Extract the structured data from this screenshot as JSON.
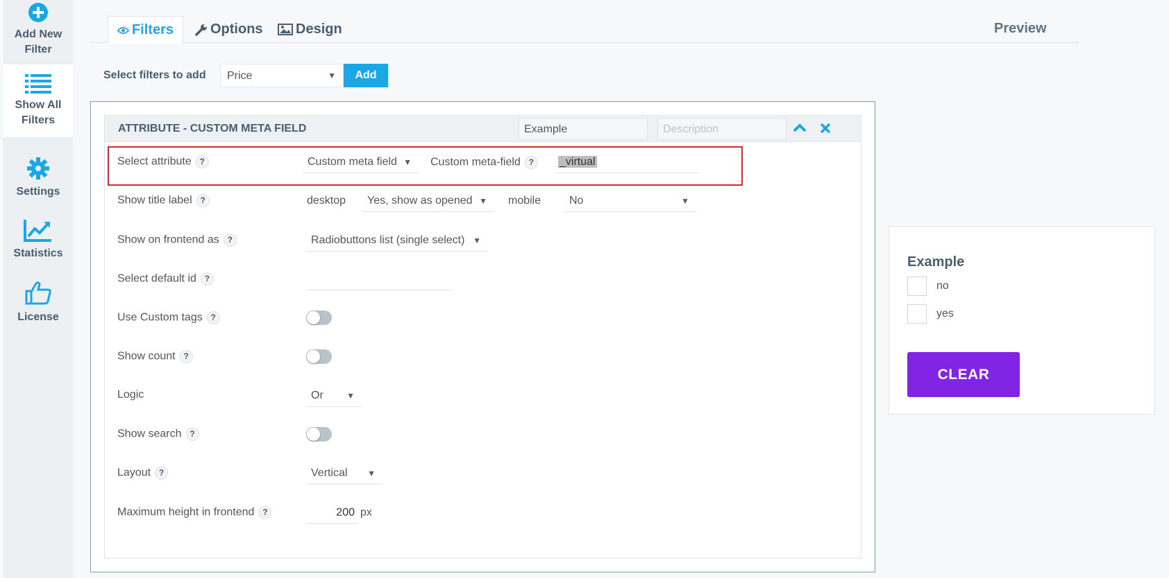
{
  "sidebar": {
    "items": [
      {
        "label_line1": "Add New",
        "label_line2": "Filter",
        "icon": "plus-circle-icon"
      },
      {
        "label_line1": "Show All",
        "label_line2": "Filters",
        "icon": "list-icon"
      },
      {
        "label_line1": "Settings",
        "icon": "gear-icon"
      },
      {
        "label_line1": "Statistics",
        "icon": "chart-line-icon"
      },
      {
        "label_line1": "License",
        "icon": "thumbs-up-icon"
      }
    ]
  },
  "tabs": {
    "filters": "Filters",
    "options": "Options",
    "design": "Design",
    "active": "Filters"
  },
  "preview": {
    "title": "Preview",
    "filter_title": "Example",
    "options": [
      "no",
      "yes"
    ],
    "clear_label": "CLEAR"
  },
  "add_filter": {
    "label": "Select filters to add",
    "selected": "Price",
    "add_label": "Add"
  },
  "panel": {
    "title": "ATTRIBUTE - CUSTOM META FIELD",
    "name_value": "Example",
    "description_placeholder": "Description",
    "rows": {
      "select_attribute": {
        "label": "Select attribute",
        "value": "Custom meta field",
        "meta_label": "Custom meta-field",
        "meta_value": "_virtual"
      },
      "show_title_label": {
        "label": "Show title label",
        "desktop_label": "desktop",
        "desktop_value": "Yes, show as opened",
        "mobile_label": "mobile",
        "mobile_value": "No"
      },
      "show_on_frontend": {
        "label": "Show on frontend as",
        "value": "Radiobuttons list (single select)"
      },
      "default_id": {
        "label": "Select default id",
        "value": ""
      },
      "custom_tags": {
        "label": "Use Custom tags",
        "enabled": false
      },
      "show_count": {
        "label": "Show count",
        "enabled": false
      },
      "logic": {
        "label": "Logic",
        "value": "Or"
      },
      "show_search": {
        "label": "Show search",
        "enabled": false
      },
      "layout": {
        "label": "Layout",
        "value": "Vertical"
      },
      "max_height": {
        "label": "Maximum height in frontend",
        "value": "200",
        "unit": "px"
      }
    }
  },
  "colors": {
    "accent": "#1ba6e6",
    "clear_button": "#8224e3",
    "highlight": "#e0252a"
  }
}
